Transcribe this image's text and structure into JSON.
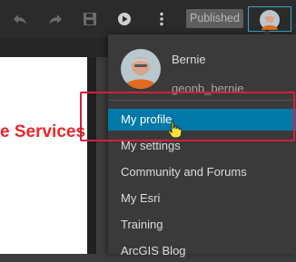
{
  "toolbar": {
    "published_label": "Published",
    "icons": [
      "undo-icon",
      "redo-icon",
      "save-icon",
      "play-icon",
      "more-vertical-icon"
    ]
  },
  "canvas": {
    "heading_text": "e Services",
    "heading_color": "#e8262c"
  },
  "user_menu": {
    "name": "Bernie",
    "username": "geonb_bernie",
    "items": [
      {
        "label": "My profile",
        "active": true
      },
      {
        "label": "My settings"
      },
      {
        "label": "Community and Forums"
      },
      {
        "label": "My Esri"
      },
      {
        "label": "Training"
      },
      {
        "label": "ArcGIS Blog"
      }
    ]
  },
  "colors": {
    "accent": "#0079a8",
    "highlight_box": "#d3203f",
    "toolbar_bg": "#2b2b2b",
    "menu_bg": "#3a3a3a"
  }
}
